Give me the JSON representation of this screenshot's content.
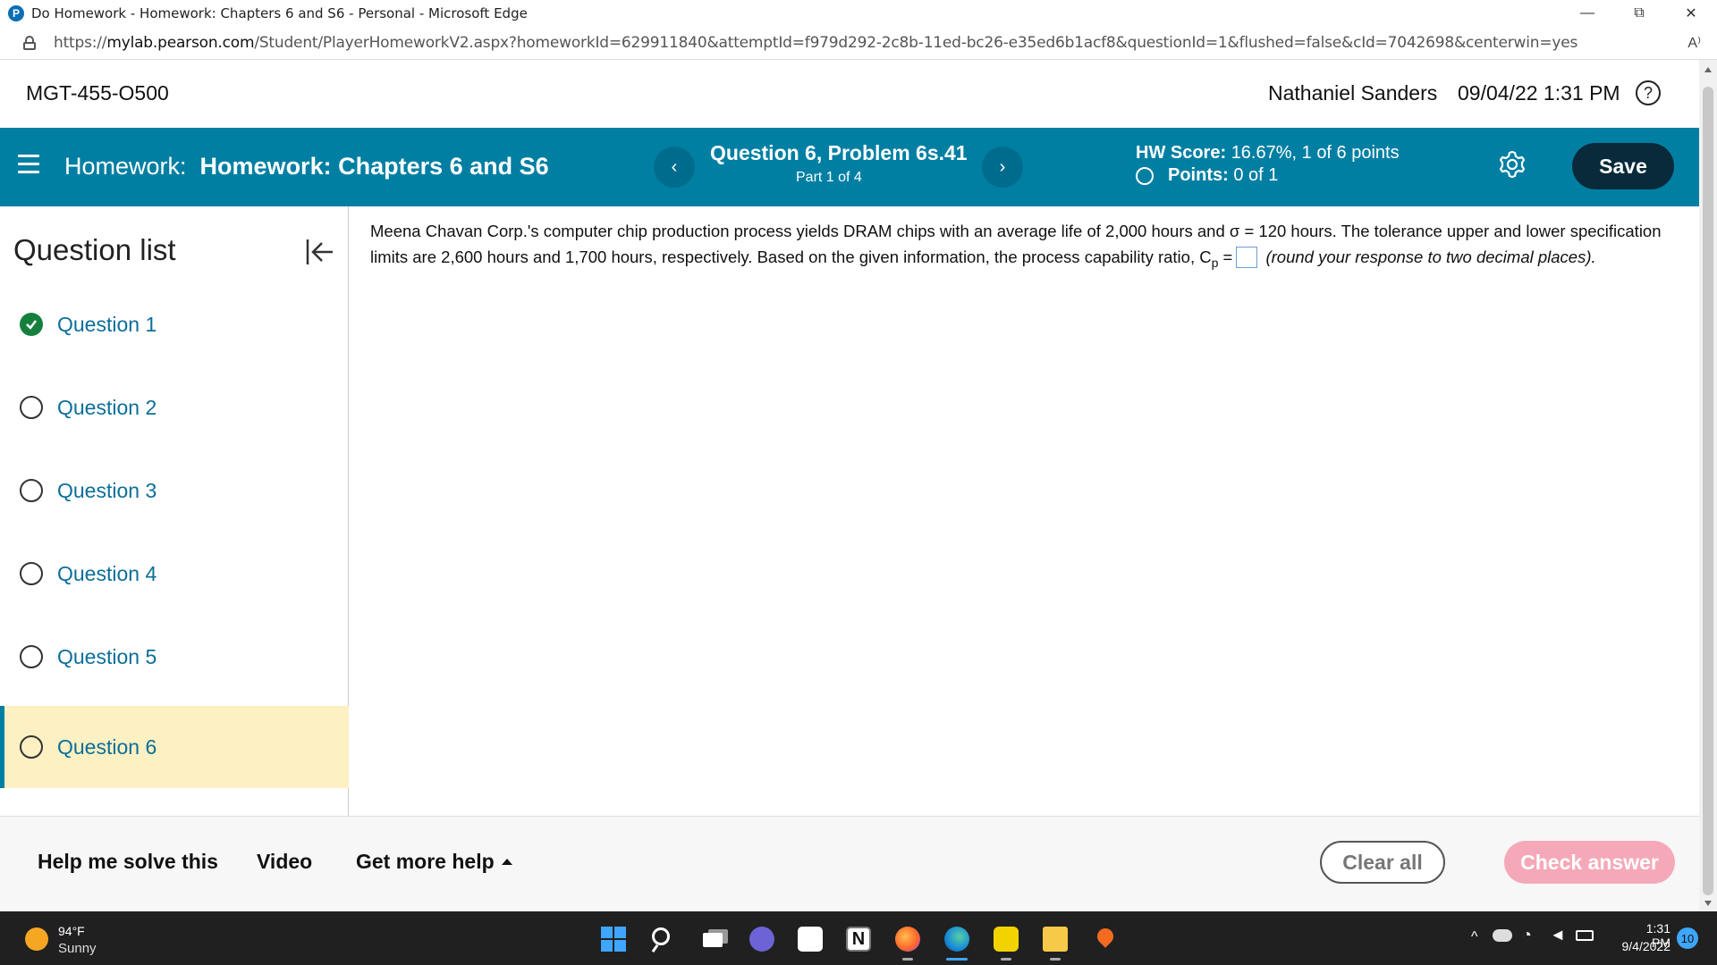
{
  "browser": {
    "window_title": "Do Homework - Homework: Chapters 6 and S6 - Personal - Microsoft Edge",
    "app_icon_letter": "P",
    "url_prefix": "https://",
    "url_host": "mylab.pearson.com",
    "url_path": "/Student/PlayerHomeworkV2.aspx?homeworkId=629911840&attemptId=f979d292-2c8b-11ed-bc26-e35ed6b1acf8&questionId=1&flushed=false&cId=7042698&centerwin=yes",
    "read_aloud_glyph": "A⁾",
    "minimize_glyph": "—",
    "restore_glyph": "⧉",
    "close_glyph": "✕"
  },
  "course_header": {
    "course_code": "MGT-455-O500",
    "student_name": "Nathaniel Sanders",
    "datetime": "09/04/22 1:31 PM",
    "help_glyph": "?"
  },
  "hwbar": {
    "homework_label": "Homework:",
    "homework_name": "Homework: Chapters 6 and S6",
    "prev_glyph": "‹",
    "next_glyph": "›",
    "question_title": "Question 6, Problem 6s.41",
    "part_label": "Part 1 of 4",
    "hw_score_label": "HW Score:",
    "hw_score_value": "16.67%, 1 of 6 points",
    "points_label": "Points:",
    "points_value": "0 of 1",
    "save_label": "Save"
  },
  "sidebar": {
    "title": "Question list",
    "items": [
      {
        "label": "Question 1",
        "status": "complete"
      },
      {
        "label": "Question 2",
        "status": "incomplete"
      },
      {
        "label": "Question 3",
        "status": "incomplete"
      },
      {
        "label": "Question 4",
        "status": "incomplete"
      },
      {
        "label": "Question 5",
        "status": "incomplete"
      },
      {
        "label": "Question 6",
        "status": "current"
      }
    ]
  },
  "question": {
    "text_part1": "Meena Chavan Corp.'s computer chip production process yields DRAM chips with an average life of 2,000 hours and σ = 120 hours.  The tolerance upper and lower specification limits are 2,600 hours and 1,700 hours, respectively.  Based on the given information, the process capability ratio, C",
    "subscript": "p",
    "equals": " =",
    "instruction": "(round your response to two decimal places).",
    "answer_value": ""
  },
  "footer": {
    "help_solve_label": "Help me solve this",
    "video_label": "Video",
    "more_help_label": "Get more help",
    "clear_label": "Clear all",
    "check_label": "Check answer"
  },
  "taskbar": {
    "temperature": "94°F",
    "weather": "Sunny",
    "notion_letter": "N",
    "tray_arrow": "^",
    "wifi_glyph": "◔",
    "volume_glyph": "◄",
    "clock_time": "1:31 PM",
    "clock_date": "9/4/2022",
    "notification_count": "10"
  },
  "colors": {
    "brand_blue": "#007fa3",
    "save_dark": "#082a3a",
    "current_highlight": "#fdf0c2",
    "complete_green": "#15803d",
    "check_disabled_pink": "#f5a9b8"
  }
}
